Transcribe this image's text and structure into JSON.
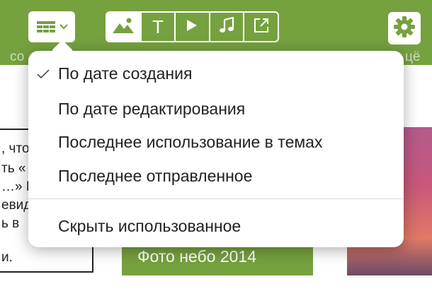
{
  "toolbar": {
    "view_button_icon": "grid-chevron-icon",
    "left_label": "со",
    "right_label": "цё",
    "filters": [
      {
        "icon": "image-icon",
        "selected": true
      },
      {
        "icon": "text-icon",
        "glyph": "T",
        "selected": false
      },
      {
        "icon": "play-icon",
        "selected": false
      },
      {
        "icon": "music-note-icon",
        "selected": false
      },
      {
        "icon": "external-link-icon",
        "selected": false
      }
    ],
    "settings_icon": "gear-icon"
  },
  "background": {
    "card_text_lines": [
      ", что",
      "ть «",
      "…» Н",
      "евид",
      "ь в",
      "и."
    ],
    "photo_title": "Фото небо 2014"
  },
  "menu": {
    "sort_options": [
      {
        "label": "По дате создания",
        "checked": true
      },
      {
        "label": "По дате редактирования",
        "checked": false
      },
      {
        "label": "Последнее использование в темах",
        "checked": false
      },
      {
        "label": "Последнее отправленное",
        "checked": false
      }
    ],
    "hide_used_label": "Скрыть использованное"
  },
  "colors": {
    "accent": "#76a13f",
    "menu_bg": "#ffffff",
    "text": "#222222"
  }
}
